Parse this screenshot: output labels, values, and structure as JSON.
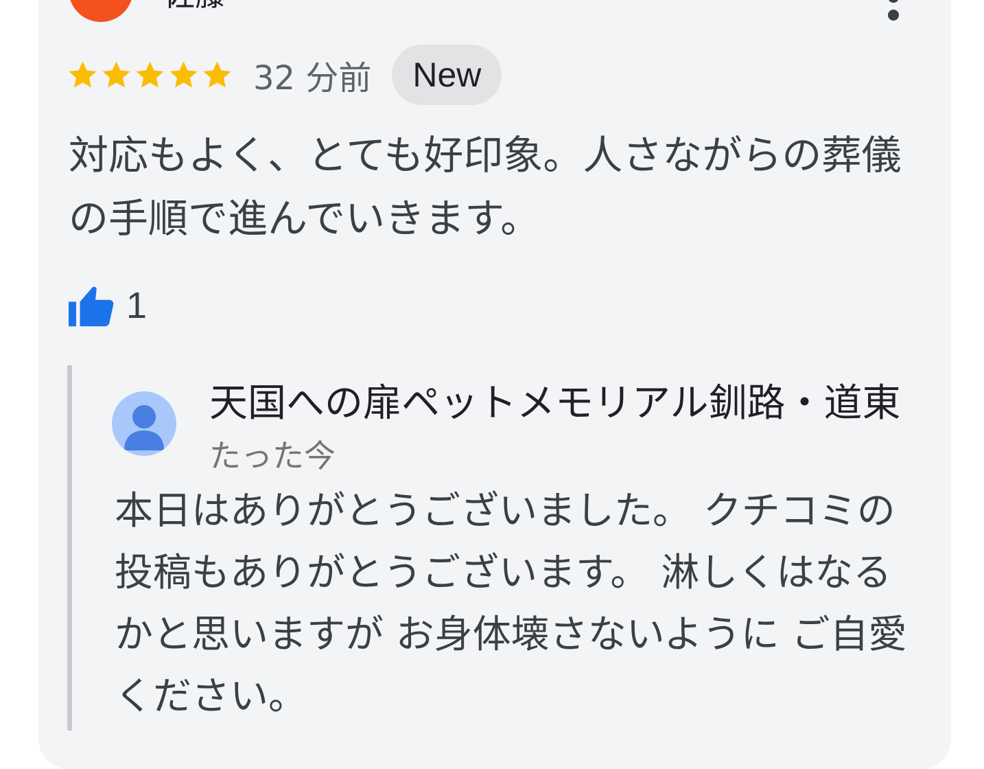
{
  "review": {
    "reviewer_name": "佐藤",
    "star_rating": 5,
    "time_ago": "32 分前",
    "badge": "New",
    "text": "対応もよく、とても好印象。人さながらの葬儀の手順で進んでいきます。",
    "like_count": "1"
  },
  "reply": {
    "owner_name": "天国への扉ペットメモリアル釧路・道東",
    "time": "たった今",
    "text": "本日はありがとうございました。 クチコミの投稿もありがとうございます。 淋しくはなるかと思いますが お身体壊さないように ご自愛ください。"
  },
  "colors": {
    "star": "#fbbc04",
    "like_icon": "#1a73e8",
    "card_background": "#f3f4f6",
    "badge_background": "#e2e3e5",
    "reviewer_avatar": "#f4511e",
    "owner_avatar_background": "#a8c7fa",
    "owner_avatar_figure": "#4a7ee0"
  },
  "icons": {
    "rating": "star-icon",
    "like": "thumbs-up-icon",
    "menu": "more-vert-icon",
    "owner_avatar": "person-icon"
  }
}
